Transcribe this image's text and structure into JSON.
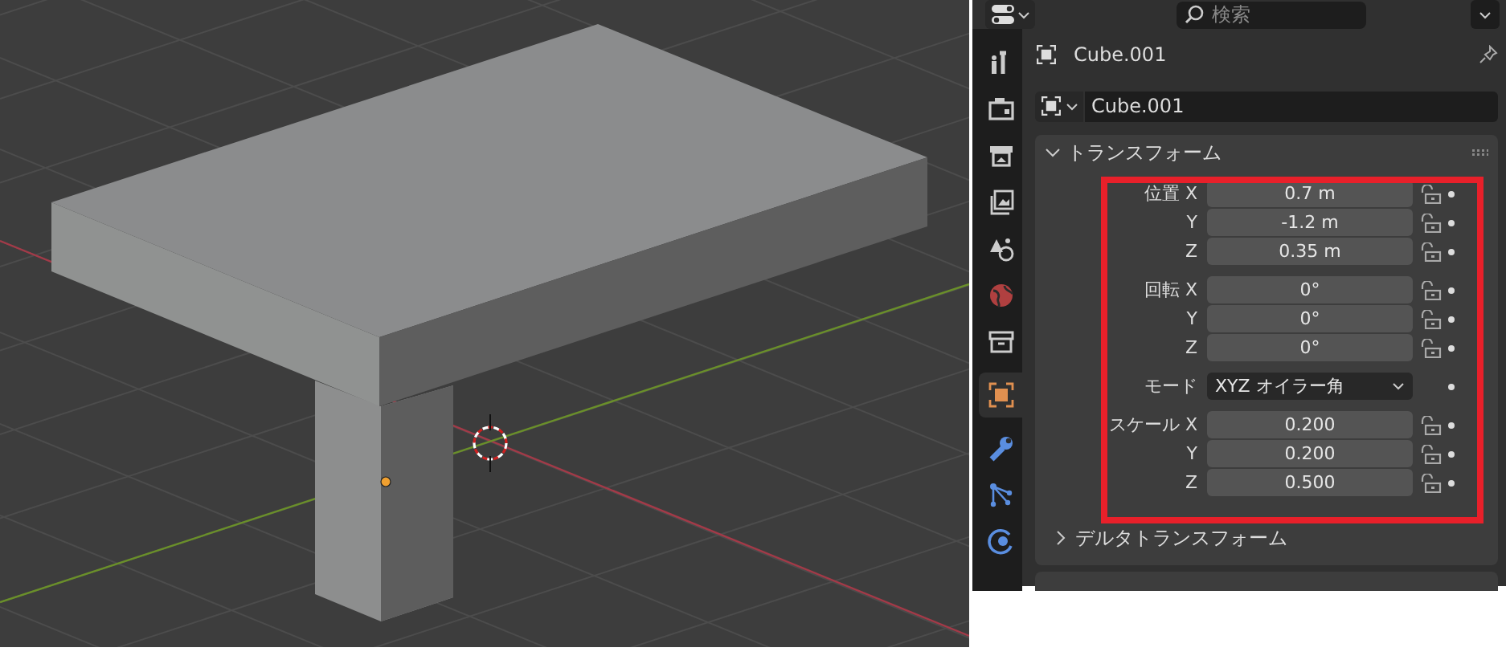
{
  "header": {
    "search": {
      "placeholder": "検索"
    }
  },
  "sidebar_tabs": [
    {
      "kind": "tool",
      "selected": false
    },
    {
      "kind": "render",
      "selected": false
    },
    {
      "kind": "output",
      "selected": false
    },
    {
      "kind": "view_layer",
      "selected": false
    },
    {
      "kind": "scene",
      "selected": false
    },
    {
      "kind": "world",
      "selected": false
    },
    {
      "kind": "collection",
      "selected": false
    },
    {
      "kind": "object",
      "selected": true
    },
    {
      "kind": "modifier",
      "selected": false
    },
    {
      "kind": "particles",
      "selected": false
    },
    {
      "kind": "physics",
      "selected": false
    }
  ],
  "object": {
    "name": "Cube.001"
  },
  "data_block": {
    "value": "Cube.001"
  },
  "transform_panel": {
    "title": "トランスフォーム",
    "expanded": true,
    "groups": [
      {
        "rows": [
          {
            "kind": "number",
            "label": "位置 X",
            "value": "0.7 m",
            "locked": false
          },
          {
            "kind": "number",
            "label": "Y",
            "value": "-1.2 m",
            "locked": false
          },
          {
            "kind": "number",
            "label": "Z",
            "value": "0.35 m",
            "locked": false
          }
        ]
      },
      {
        "rows": [
          {
            "kind": "number",
            "label": "回転 X",
            "value": "0°",
            "locked": false
          },
          {
            "kind": "number",
            "label": "Y",
            "value": "0°",
            "locked": false
          },
          {
            "kind": "number",
            "label": "Z",
            "value": "0°",
            "locked": false
          }
        ]
      },
      {
        "rows": [
          {
            "kind": "dropdown",
            "label": "モード",
            "value": "XYZ オイラー角"
          }
        ]
      },
      {
        "rows": [
          {
            "kind": "number",
            "label": "スケール X",
            "value": "0.200",
            "locked": false
          },
          {
            "kind": "number",
            "label": "Y",
            "value": "0.200",
            "locked": false
          },
          {
            "kind": "number",
            "label": "Z",
            "value": "0.500",
            "locked": false
          }
        ]
      }
    ],
    "subpanel": {
      "title": "デルタトランスフォーム",
      "expanded": false
    }
  }
}
